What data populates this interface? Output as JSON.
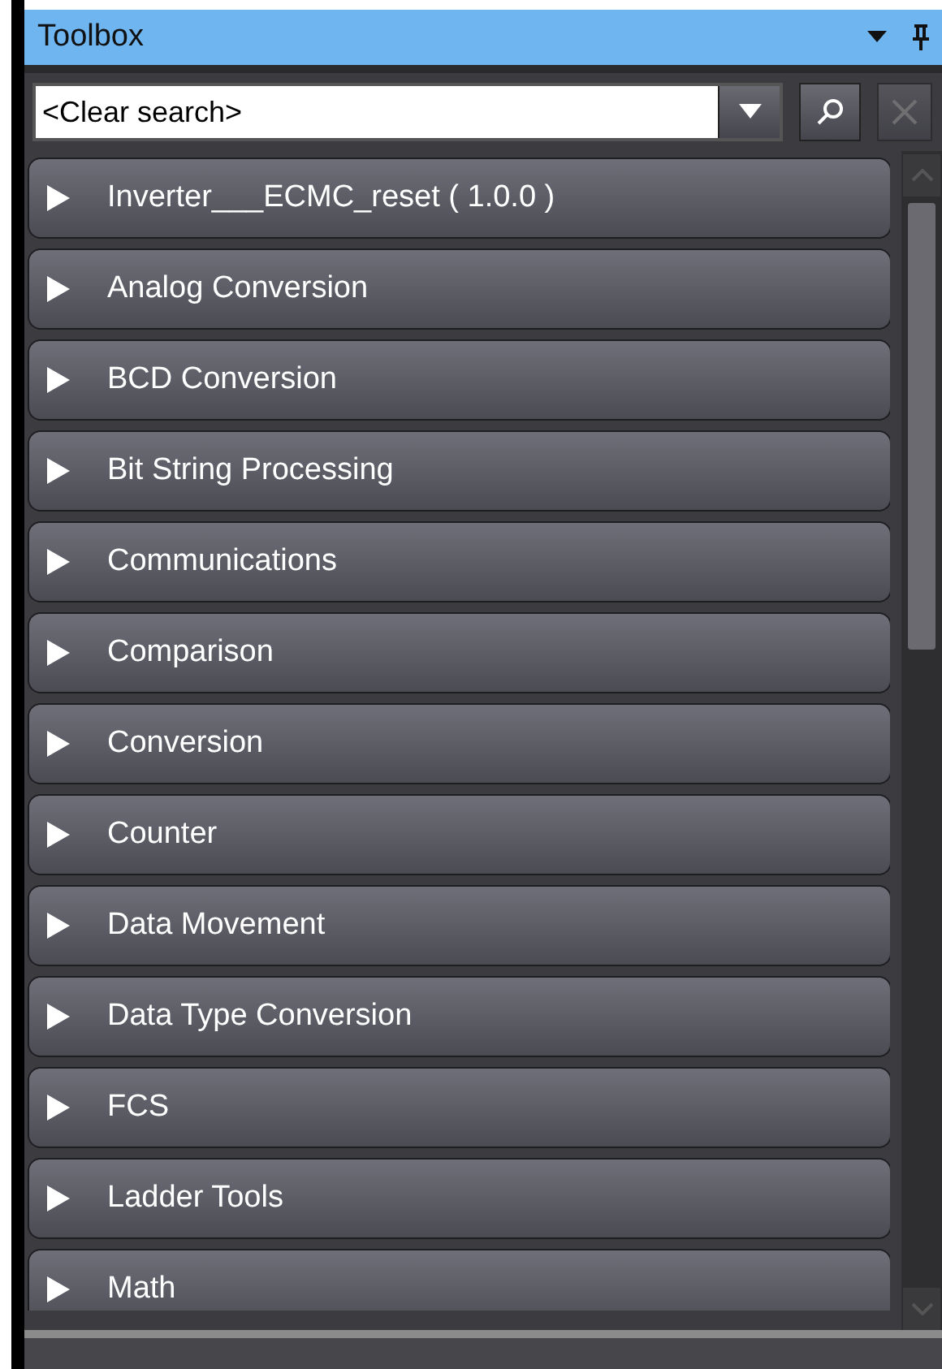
{
  "panel": {
    "title": "Toolbox"
  },
  "search": {
    "value": "<Clear search>",
    "clear_disabled": true
  },
  "groups": [
    {
      "label": "Inverter___ECMC_reset ( 1.0.0 )",
      "expanded": false
    },
    {
      "label": "Analog Conversion",
      "expanded": false
    },
    {
      "label": "BCD Conversion",
      "expanded": false
    },
    {
      "label": "Bit String Processing",
      "expanded": false
    },
    {
      "label": "Communications",
      "expanded": false
    },
    {
      "label": "Comparison",
      "expanded": false
    },
    {
      "label": "Conversion",
      "expanded": false
    },
    {
      "label": "Counter",
      "expanded": false
    },
    {
      "label": "Data Movement",
      "expanded": false
    },
    {
      "label": "Data Type Conversion",
      "expanded": false
    },
    {
      "label": "FCS",
      "expanded": false
    },
    {
      "label": "Ladder Tools",
      "expanded": false
    },
    {
      "label": "Math",
      "expanded": false
    }
  ]
}
